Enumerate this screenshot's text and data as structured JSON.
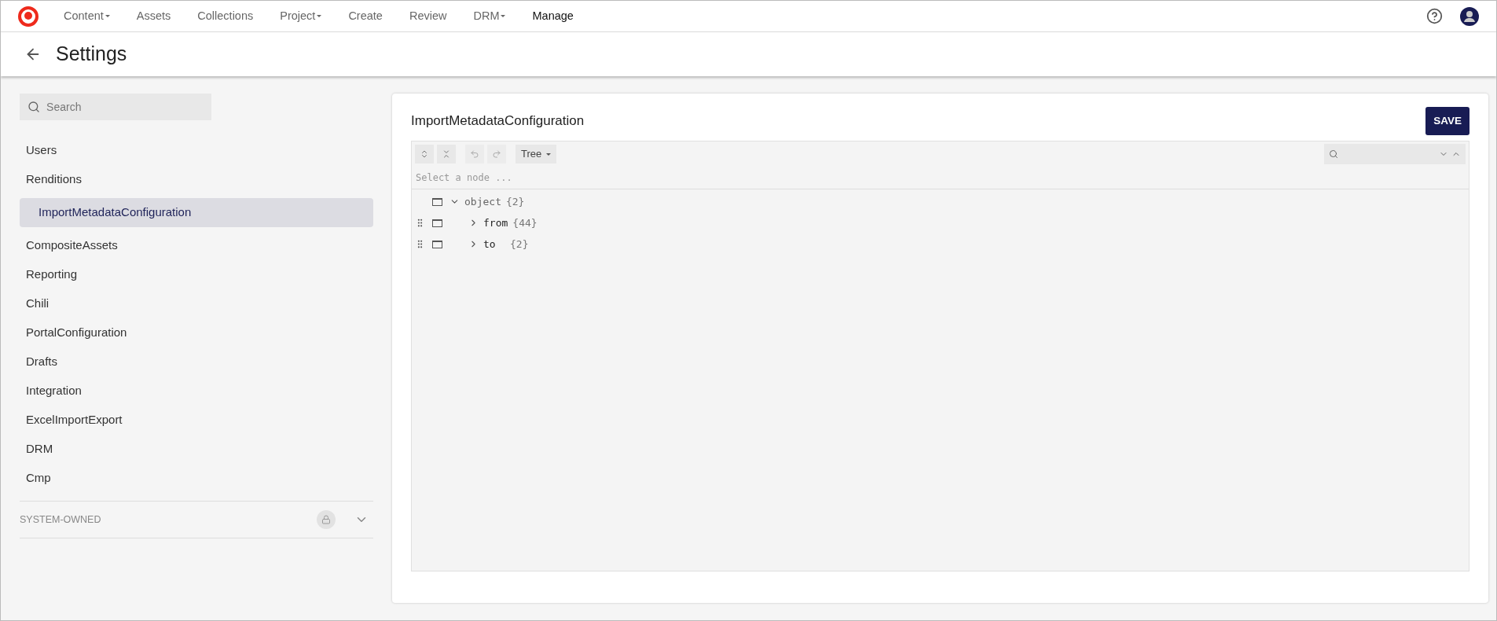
{
  "nav": {
    "items": [
      {
        "label": "Content",
        "dropdown": true,
        "selected": false
      },
      {
        "label": "Assets",
        "dropdown": false,
        "selected": false
      },
      {
        "label": "Collections",
        "dropdown": false,
        "selected": false
      },
      {
        "label": "Project",
        "dropdown": true,
        "selected": false
      },
      {
        "label": "Create",
        "dropdown": false,
        "selected": false
      },
      {
        "label": "Review",
        "dropdown": false,
        "selected": false
      },
      {
        "label": "DRM",
        "dropdown": true,
        "selected": false
      },
      {
        "label": "Manage",
        "dropdown": false,
        "selected": true
      }
    ]
  },
  "page": {
    "title": "Settings"
  },
  "sidebar": {
    "search": {
      "placeholder": "Search"
    },
    "items": [
      {
        "label": "Users",
        "selected": false
      },
      {
        "label": "Renditions",
        "selected": false,
        "children": [
          {
            "label": "ImportMetadataConfiguration",
            "selected": true
          }
        ]
      },
      {
        "label": "CompositeAssets",
        "selected": false
      },
      {
        "label": "Reporting",
        "selected": false
      },
      {
        "label": "Chili",
        "selected": false
      },
      {
        "label": "PortalConfiguration",
        "selected": false
      },
      {
        "label": "Drafts",
        "selected": false
      },
      {
        "label": "Integration",
        "selected": false
      },
      {
        "label": "ExcelImportExport",
        "selected": false
      },
      {
        "label": "DRM",
        "selected": false
      },
      {
        "label": "Cmp",
        "selected": false
      }
    ],
    "section": {
      "label": "SYSTEM-OWNED",
      "expanded": false
    }
  },
  "editor": {
    "title": "ImportMetadataConfiguration",
    "save": "SAVE",
    "mode": "Tree",
    "path_placeholder": "Select a node ...",
    "tree": [
      {
        "key": "object",
        "count": "{2}",
        "expanded": true,
        "children": [
          {
            "key": "from",
            "count": "{44}",
            "expanded": false
          },
          {
            "key": "to",
            "count": "{2}",
            "expanded": false
          }
        ]
      }
    ]
  }
}
